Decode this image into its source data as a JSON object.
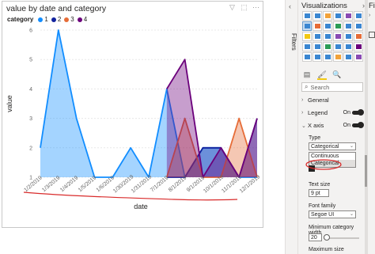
{
  "visual": {
    "title": "value by date and category",
    "toolbar": [
      "filter-icon",
      "focus-mode-icon",
      "more-options-icon"
    ],
    "toolbar_glyphs": [
      "▽",
      "⬚",
      "⋯"
    ]
  },
  "legend": {
    "title": "category",
    "items": [
      {
        "label": "1",
        "color": "#118dff"
      },
      {
        "label": "2",
        "color": "#12239e"
      },
      {
        "label": "3",
        "color": "#e66c37"
      },
      {
        "label": "4",
        "color": "#6b007b"
      }
    ]
  },
  "filters": {
    "label": "Filters",
    "chevron": "‹"
  },
  "viz_pane": {
    "title": "Visualizations",
    "collapse_glyph": "›",
    "format_tabs": [
      "fields-well-icon",
      "format-paint-roller-icon",
      "analytics-magnifier-icon"
    ],
    "format_glyphs": [
      "▤",
      "🖌",
      "🔍"
    ],
    "search_placeholder": "Search",
    "search_glyph": "⌕",
    "sections": {
      "general": "General",
      "legend": "Legend",
      "legend_state": "On",
      "x_axis": "X axis",
      "x_axis_state": "On"
    },
    "type_label": "Type",
    "type_value": "Categorical",
    "type_options": [
      "Continuous",
      "Categorical"
    ],
    "text_size_label": "Text size",
    "text_size_value": "9",
    "text_size_unit": "pt",
    "font_family_label": "Font family",
    "font_family_value": "Segoe UI",
    "min_cat_width_label": "Minimum category width",
    "min_cat_width_value": "20",
    "max_size_label": "Maximum size"
  },
  "fields_pane": {
    "title": "Fields",
    "chevron": "›"
  },
  "chart_data": {
    "type": "area",
    "title": "value by date and category",
    "xlabel": "date",
    "ylabel": "value",
    "ylim": [
      1,
      6
    ],
    "yticks": [
      1,
      2,
      3,
      4,
      5,
      6
    ],
    "x_tick_labels": [
      "1/2/2019",
      "1/3/2019",
      "1/4/2019",
      "1/5/2019",
      "1/6/2019",
      "1/30/2019",
      "1/31/2019",
      "7/1/2019",
      "8/1/2019",
      "9/1/2019",
      "10/1/2019",
      "11/1/2019",
      "12/1/2019"
    ],
    "legend_position": "top-left",
    "series": [
      {
        "name": "1",
        "color": "#118dff",
        "values": [
          2,
          6,
          3,
          1,
          1,
          2,
          1,
          4,
          1,
          2,
          2,
          1,
          1
        ]
      },
      {
        "name": "2",
        "color": "#12239e",
        "values": [
          null,
          null,
          null,
          null,
          null,
          null,
          null,
          1,
          1,
          2,
          2,
          1,
          3
        ]
      },
      {
        "name": "3",
        "color": "#e66c37",
        "values": [
          null,
          null,
          null,
          null,
          null,
          null,
          null,
          1,
          3,
          1,
          1,
          3,
          1
        ]
      },
      {
        "name": "4",
        "color": "#6b007b",
        "values": [
          null,
          null,
          null,
          null,
          null,
          null,
          null,
          4,
          5,
          1,
          2,
          1,
          3
        ]
      }
    ]
  }
}
